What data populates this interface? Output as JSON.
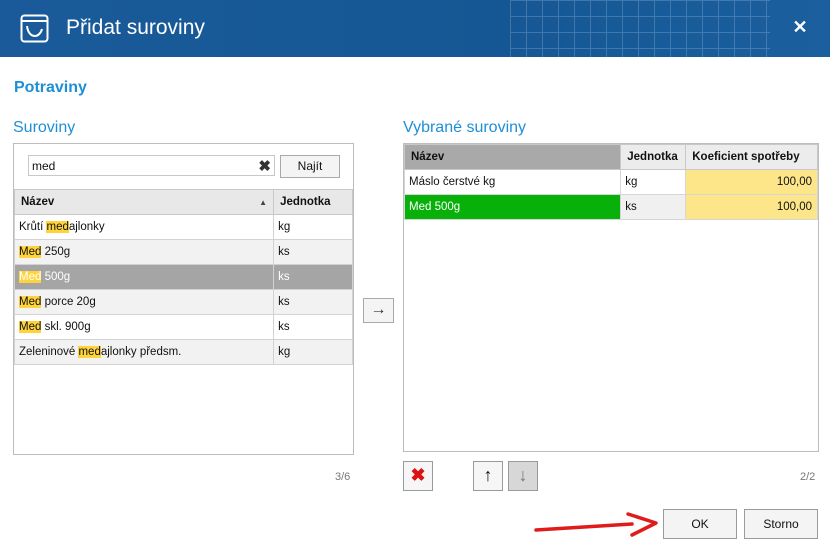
{
  "window": {
    "title": "Přidat suroviny",
    "close_glyph": "✕"
  },
  "section_title": "Potraviny",
  "left": {
    "title": "Suroviny",
    "search": {
      "value": "med",
      "clear_glyph": "✖",
      "find_label": "Najít"
    },
    "columns": [
      "Název",
      "Jednotka"
    ],
    "rows": [
      {
        "pre": "Krůtí ",
        "hl": "med",
        "post": "ajlonky",
        "unit": "kg",
        "selected": false
      },
      {
        "pre": "",
        "hl": "Med",
        "post": " 250g",
        "unit": "ks",
        "selected": false
      },
      {
        "pre": "",
        "hl": "Med",
        "post": " 500g",
        "unit": "ks",
        "selected": true
      },
      {
        "pre": "",
        "hl": "Med",
        "post": " porce 20g",
        "unit": "ks",
        "selected": false
      },
      {
        "pre": "",
        "hl": "Med",
        "post": " skl. 900g",
        "unit": "ks",
        "selected": false
      },
      {
        "pre": "Zeleninové ",
        "hl": "med",
        "post": "ajlonky  předsm.",
        "unit": "kg",
        "selected": false
      }
    ],
    "count": "3/6"
  },
  "move_right_glyph": "→",
  "right": {
    "title": "Vybrané suroviny",
    "columns": [
      "Název",
      "Jednotka",
      "Koeficient spotřeby"
    ],
    "rows": [
      {
        "name": "Máslo čerstvé kg",
        "unit": "kg",
        "coef": "100,00"
      },
      {
        "name": "Med 500g",
        "unit": "ks",
        "coef": "100,00"
      }
    ],
    "count": "2/2",
    "tools": {
      "delete_glyph": "✖",
      "up_glyph": "↑",
      "down_glyph": "↓"
    }
  },
  "buttons": {
    "ok": "OK",
    "cancel": "Storno"
  },
  "colors": {
    "titlebar": "#1a5a9a",
    "accent": "#1e8fd6",
    "highlight": "#ffd43b",
    "selected_row": "#a5a5a5",
    "green_row": "#08b10a",
    "coef_bg": "#fde68a"
  }
}
